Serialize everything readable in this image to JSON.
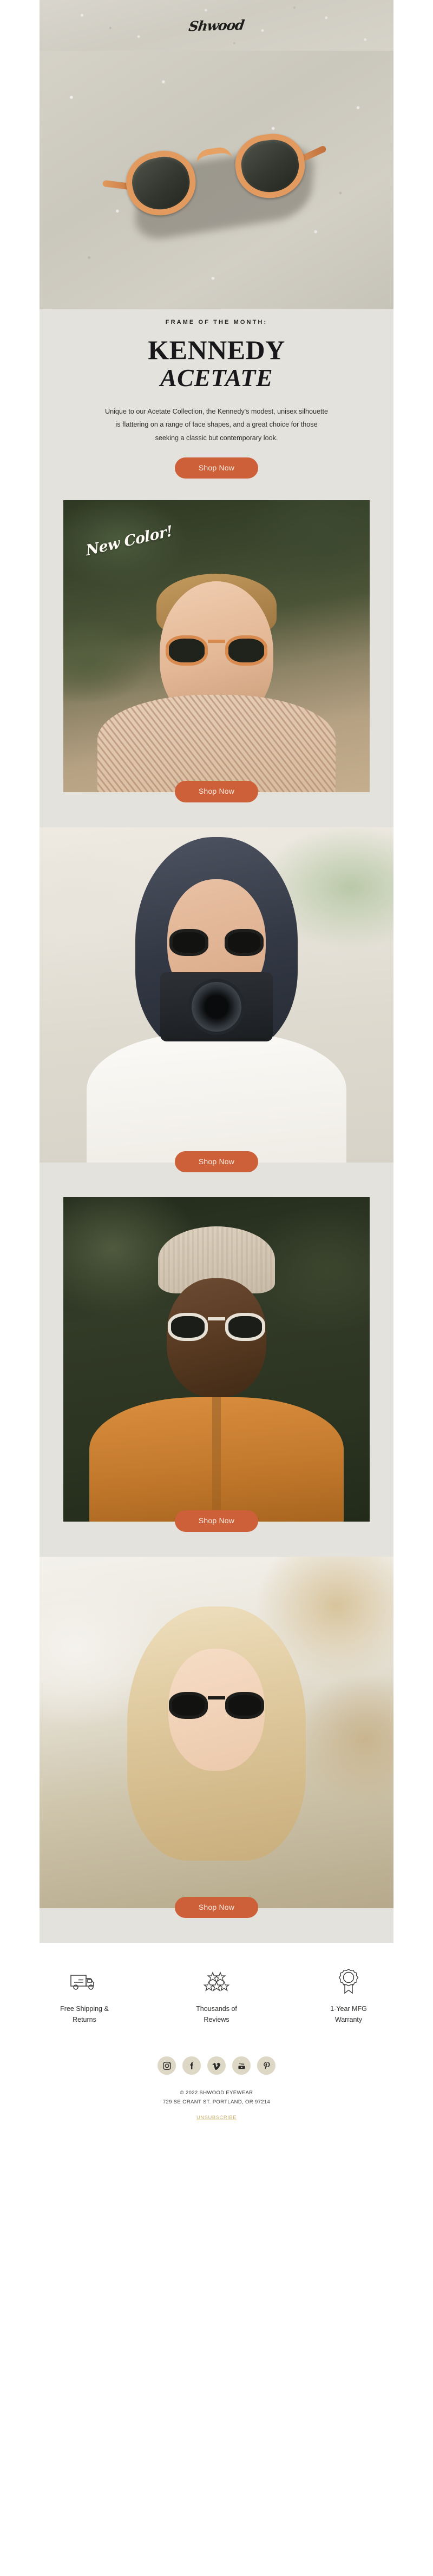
{
  "brand": {
    "logo_text": "Shwood",
    "accent_color": "#cd6038",
    "page_bg": "#e3e2dd",
    "footer_bg": "#ffffff",
    "social_chip_color": "#ddd8c6",
    "unsubscribe_color": "#c9ae6a"
  },
  "hero": {
    "eyebrow": "FRAME OF THE MONTH:",
    "headline_line1": "KENNEDY",
    "headline_line2": "ACETATE",
    "body": "Unique to our Acetate Collection, the Kennedy's modest, unisex silhouette is flattering on a range of face shapes, and a great choice for those seeking a classic but contemporary look.",
    "cta_label": "Shop Now",
    "image_alt": "kennedy-acetate-sunglasses-on-concrete"
  },
  "sections": [
    {
      "badge": "New Color!",
      "cta_label": "Shop Now",
      "image_alt": "man-wearing-kennedy-acetate-in-forest"
    },
    {
      "badge": "",
      "cta_label": "Shop Now",
      "image_alt": "woman-with-film-camera-wearing-sunglasses"
    },
    {
      "badge": "",
      "cta_label": "Shop Now",
      "image_alt": "man-in-beanie-and-orange-shirt-wearing-sunglasses"
    },
    {
      "badge": "",
      "cta_label": "Shop Now",
      "image_alt": "blonde-woman-in-golden-field-wearing-sunglasses"
    }
  ],
  "footer": {
    "features": [
      {
        "icon": "truck-icon",
        "label": "Free Shipping &\nReturns",
        "line1": "Free Shipping &",
        "line2": "Returns"
      },
      {
        "icon": "stars-icon",
        "label": "Thousands of\nReviews",
        "line1": "Thousands of",
        "line2": "Reviews"
      },
      {
        "icon": "award-icon",
        "label": "1-Year MFG\nWarranty",
        "line1": "1-Year MFG",
        "line2": "Warranty"
      }
    ],
    "socials": [
      {
        "name": "instagram-icon",
        "label": "Instagram"
      },
      {
        "name": "facebook-icon",
        "label": "Facebook"
      },
      {
        "name": "vimeo-icon",
        "label": "Vimeo"
      },
      {
        "name": "youtube-icon",
        "label": "YouTube"
      },
      {
        "name": "pinterest-icon",
        "label": "Pinterest"
      }
    ],
    "copyright": "© 2022 SHWOOD EYEWEAR",
    "address": "729 SE GRANT ST. PORTLAND, OR 97214",
    "unsubscribe": "UNSUBSCRIBE"
  }
}
